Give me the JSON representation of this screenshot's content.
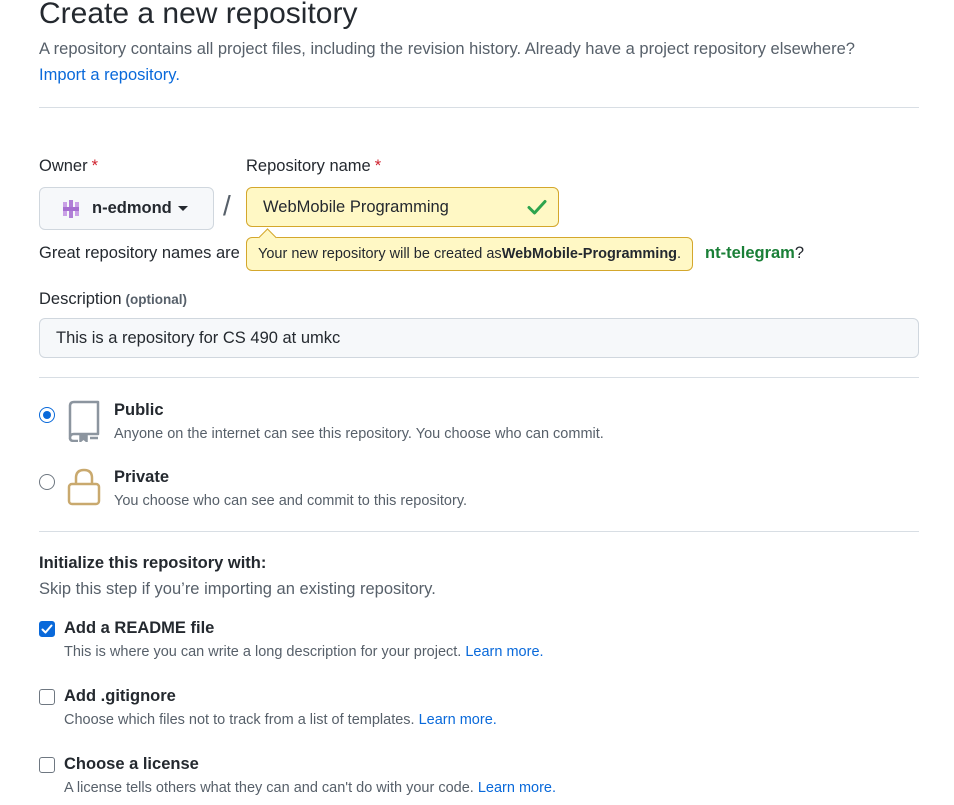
{
  "header": {
    "title": "Create a new repository",
    "subtitle": "A repository contains all project files, including the revision history. Already have a project repository elsewhere?",
    "import_link": "Import a repository."
  },
  "owner": {
    "label": "Owner",
    "required_mark": "*",
    "value": "n-edmond"
  },
  "separator": "/",
  "repo_name": {
    "label": "Repository name",
    "required_mark": "*",
    "value": "WebMobile Programming"
  },
  "name_hint": {
    "prefix": "Great repository names are",
    "suggestion_visible": "nt-telegram",
    "suffix": "?"
  },
  "tooltip": {
    "prefix": "Your new repository will be created as ",
    "name": "WebMobile-Programming",
    "suffix": "."
  },
  "description": {
    "label": "Description",
    "optional": "(optional)",
    "value": "This is a repository for CS 490 at umkc"
  },
  "visibility": {
    "selected": "public",
    "options": [
      {
        "key": "public",
        "title": "Public",
        "desc": "Anyone on the internet can see this repository. You choose who can commit."
      },
      {
        "key": "private",
        "title": "Private",
        "desc": "You choose who can see and commit to this repository."
      }
    ]
  },
  "init": {
    "title": "Initialize this repository with:",
    "subtitle": "Skip this step if you’re importing an existing repository.",
    "learn_more": "Learn more.",
    "options": [
      {
        "title": "Add a README file",
        "desc": "This is where you can write a long description for your project.",
        "checked": true
      },
      {
        "title": "Add .gitignore",
        "desc": "Choose which files not to track from a list of templates.",
        "checked": false
      },
      {
        "title": "Choose a license",
        "desc": "A license tells others what they can and can't do with your code.",
        "checked": false
      }
    ]
  },
  "colors": {
    "link": "#0969da",
    "success": "#2da44e",
    "warning_bg": "#fff8c5",
    "warning_border": "#d4a72c"
  }
}
